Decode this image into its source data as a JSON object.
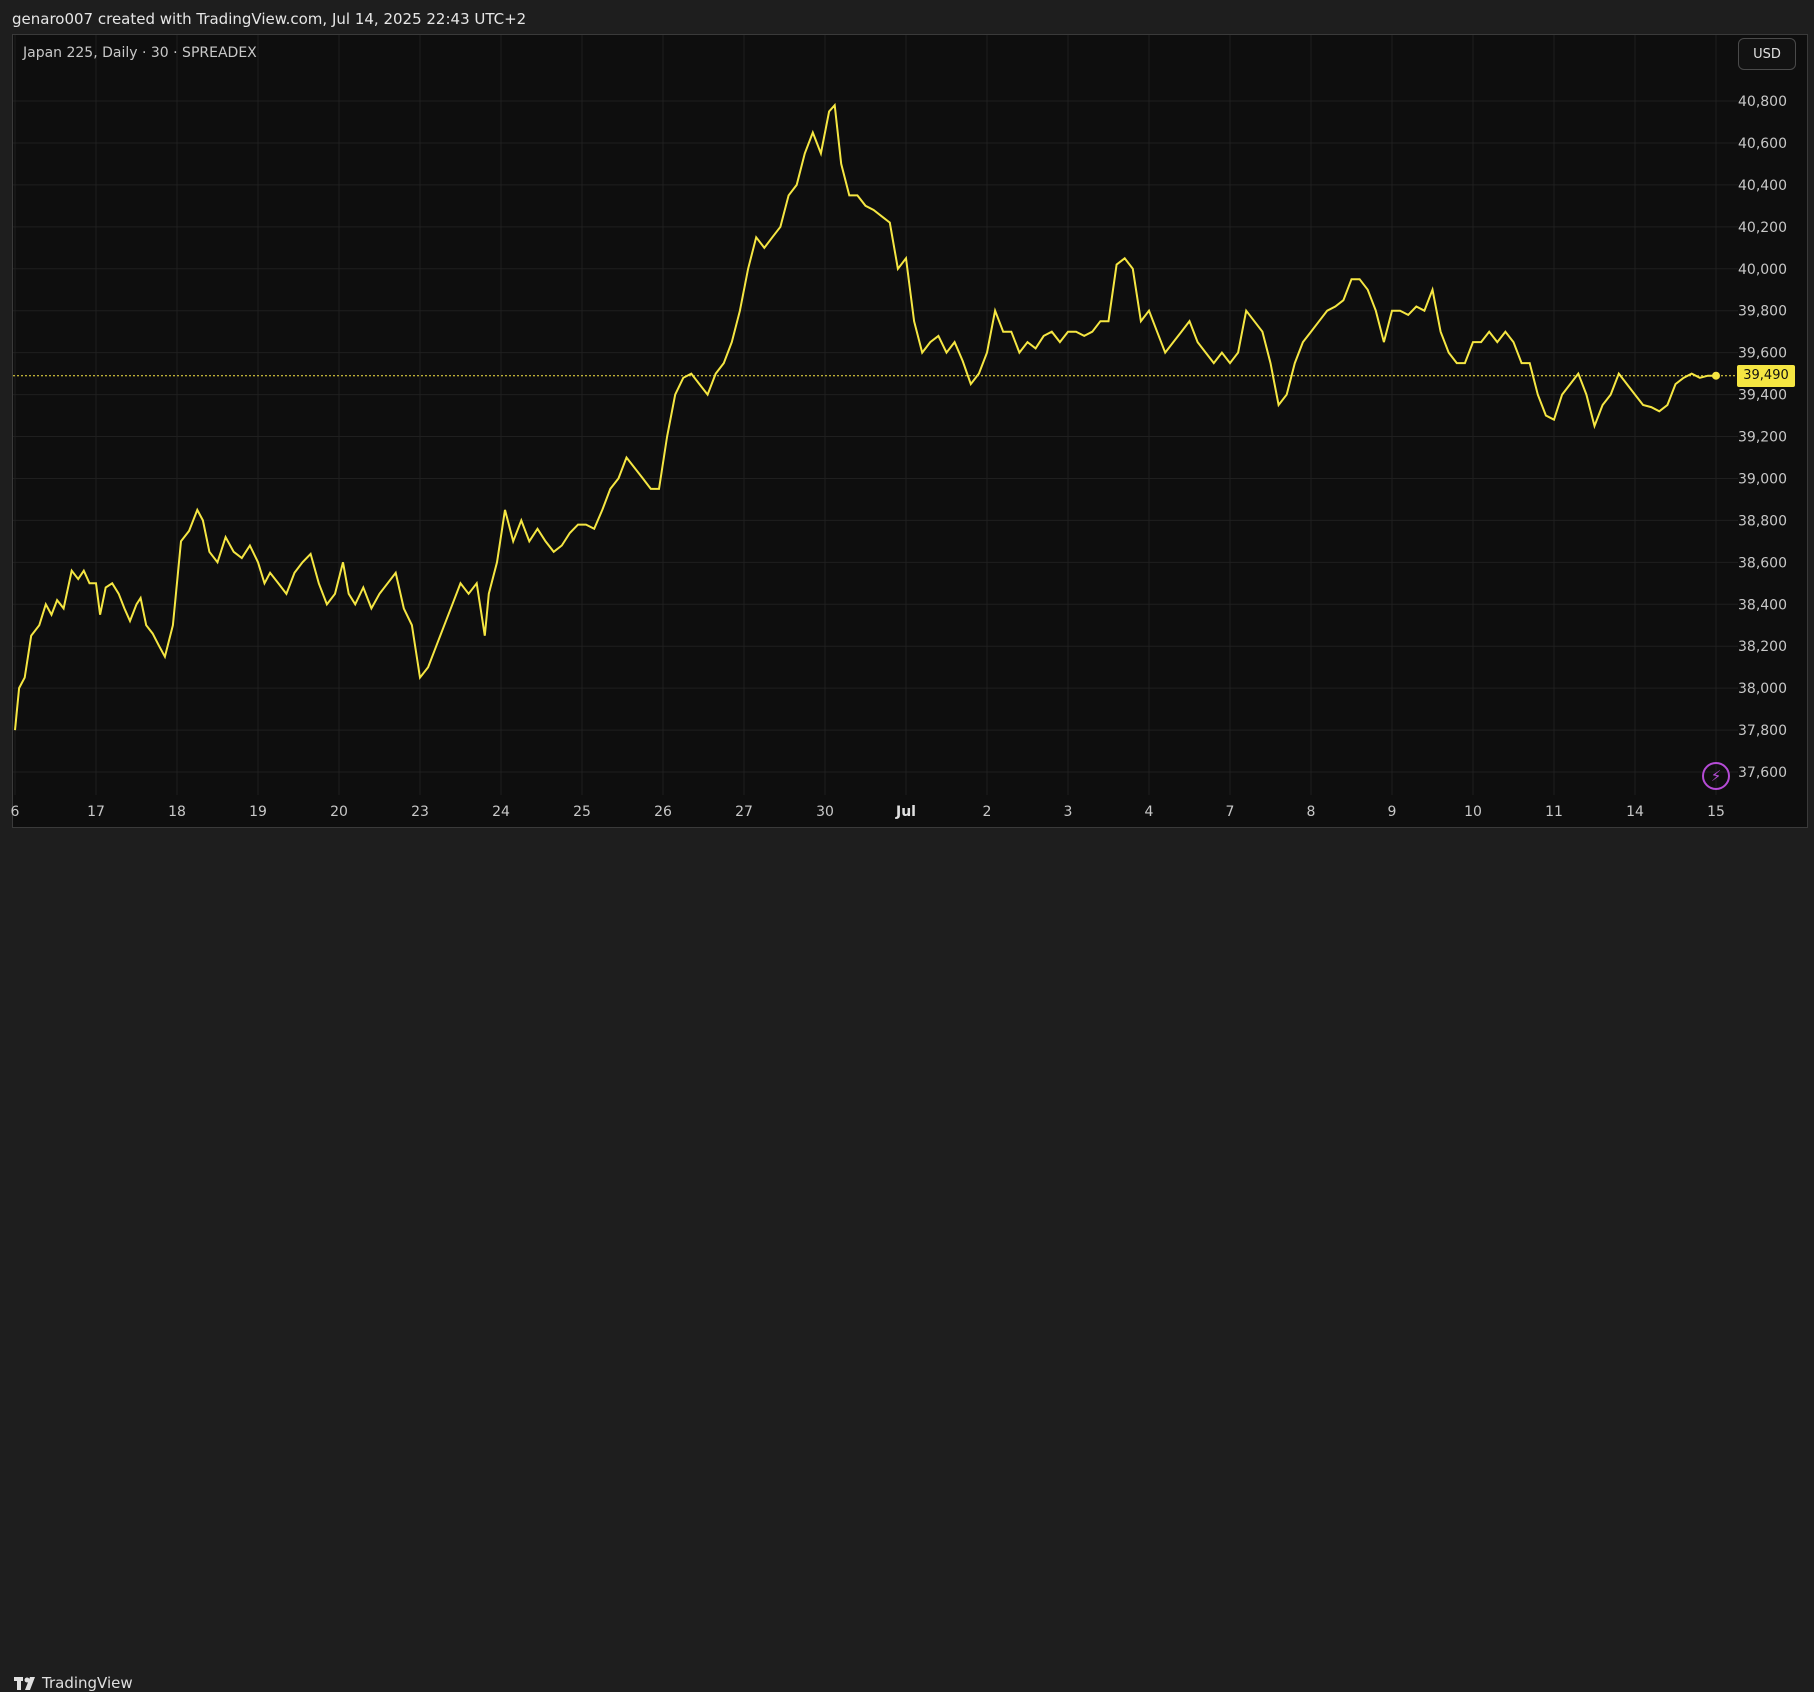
{
  "header": {
    "caption": "genaro007 created with TradingView.com, Jul 14, 2025 22:43 UTC+2"
  },
  "chart_header": {
    "symbol_info": "Japan 225, Daily · 30 · SPREADEX",
    "currency_label": "USD"
  },
  "footer": {
    "brand": "TradingView",
    "logo_icon": "tradingview-logo-icon"
  },
  "colors": {
    "line": "#f5e642",
    "price_label_bg": "#f5e642",
    "background": "#0e0e0e",
    "grid": "#1f1f1f",
    "bolt": "#b54bd6"
  },
  "chart_data": {
    "type": "line",
    "title": "",
    "xlabel": "",
    "ylabel": "",
    "ylim": [
      37550,
      40900
    ],
    "y_ticks": [
      37600,
      37800,
      38000,
      38200,
      38400,
      38600,
      38800,
      39000,
      39200,
      39400,
      39600,
      39800,
      40000,
      40200,
      40400,
      40600,
      40800
    ],
    "y_tick_labels": [
      "37,600",
      "37,800",
      "38,000",
      "38,200",
      "38,400",
      "38,600",
      "38,800",
      "39,000",
      "39,200",
      "39,400",
      "39,600",
      "39,800",
      "40,000",
      "40,200",
      "40,400",
      "40,600",
      "40,800"
    ],
    "x_ticks": [
      {
        "label": "6",
        "t": 0.0
      },
      {
        "label": "17",
        "t": 1.0
      },
      {
        "label": "18",
        "t": 2.0
      },
      {
        "label": "19",
        "t": 3.0
      },
      {
        "label": "20",
        "t": 4.0
      },
      {
        "label": "23",
        "t": 5.0
      },
      {
        "label": "24",
        "t": 6.0
      },
      {
        "label": "25",
        "t": 7.0
      },
      {
        "label": "26",
        "t": 8.0
      },
      {
        "label": "27",
        "t": 9.0
      },
      {
        "label": "30",
        "t": 10.0
      },
      {
        "label": "Jul",
        "t": 11.0,
        "bold": true
      },
      {
        "label": "2",
        "t": 12.0
      },
      {
        "label": "3",
        "t": 13.0
      },
      {
        "label": "4",
        "t": 14.0
      },
      {
        "label": "7",
        "t": 15.0
      },
      {
        "label": "8",
        "t": 16.0
      },
      {
        "label": "9",
        "t": 17.0
      },
      {
        "label": "10",
        "t": 18.0
      },
      {
        "label": "11",
        "t": 19.0
      },
      {
        "label": "14",
        "t": 20.0
      },
      {
        "label": "15",
        "t": 21.0
      }
    ],
    "last_price": 39490,
    "last_price_label": "39,490",
    "grid": true,
    "series": [
      {
        "points": [
          [
            0.0,
            37800
          ],
          [
            0.05,
            38000
          ],
          [
            0.12,
            38050
          ],
          [
            0.2,
            38250
          ],
          [
            0.3,
            38300
          ],
          [
            0.38,
            38400
          ],
          [
            0.45,
            38350
          ],
          [
            0.52,
            38420
          ],
          [
            0.6,
            38380
          ],
          [
            0.7,
            38560
          ],
          [
            0.78,
            38520
          ],
          [
            0.85,
            38560
          ],
          [
            0.92,
            38500
          ],
          [
            1.0,
            38500
          ],
          [
            1.05,
            38350
          ],
          [
            1.12,
            38480
          ],
          [
            1.2,
            38500
          ],
          [
            1.28,
            38450
          ],
          [
            1.35,
            38380
          ],
          [
            1.42,
            38320
          ],
          [
            1.5,
            38400
          ],
          [
            1.55,
            38430
          ],
          [
            1.62,
            38300
          ],
          [
            1.7,
            38260
          ],
          [
            1.78,
            38200
          ],
          [
            1.85,
            38150
          ],
          [
            1.95,
            38300
          ],
          [
            2.05,
            38700
          ],
          [
            2.15,
            38750
          ],
          [
            2.25,
            38850
          ],
          [
            2.32,
            38800
          ],
          [
            2.4,
            38650
          ],
          [
            2.5,
            38600
          ],
          [
            2.6,
            38720
          ],
          [
            2.7,
            38650
          ],
          [
            2.8,
            38620
          ],
          [
            2.9,
            38680
          ],
          [
            3.0,
            38600
          ],
          [
            3.08,
            38500
          ],
          [
            3.15,
            38550
          ],
          [
            3.25,
            38500
          ],
          [
            3.35,
            38450
          ],
          [
            3.45,
            38550
          ],
          [
            3.55,
            38600
          ],
          [
            3.65,
            38640
          ],
          [
            3.75,
            38500
          ],
          [
            3.85,
            38400
          ],
          [
            3.95,
            38450
          ],
          [
            4.05,
            38600
          ],
          [
            4.12,
            38450
          ],
          [
            4.2,
            38400
          ],
          [
            4.3,
            38480
          ],
          [
            4.4,
            38380
          ],
          [
            4.5,
            38450
          ],
          [
            4.6,
            38500
          ],
          [
            4.7,
            38550
          ],
          [
            4.8,
            38380
          ],
          [
            4.9,
            38300
          ],
          [
            5.0,
            38050
          ],
          [
            5.1,
            38100
          ],
          [
            5.2,
            38200
          ],
          [
            5.3,
            38300
          ],
          [
            5.4,
            38400
          ],
          [
            5.5,
            38500
          ],
          [
            5.6,
            38450
          ],
          [
            5.7,
            38500
          ],
          [
            5.8,
            38250
          ],
          [
            5.85,
            38450
          ],
          [
            5.95,
            38600
          ],
          [
            6.05,
            38850
          ],
          [
            6.15,
            38700
          ],
          [
            6.25,
            38800
          ],
          [
            6.35,
            38700
          ],
          [
            6.45,
            38760
          ],
          [
            6.55,
            38700
          ],
          [
            6.65,
            38650
          ],
          [
            6.75,
            38680
          ],
          [
            6.85,
            38740
          ],
          [
            6.95,
            38780
          ],
          [
            7.05,
            38780
          ],
          [
            7.15,
            38760
          ],
          [
            7.25,
            38850
          ],
          [
            7.35,
            38950
          ],
          [
            7.45,
            39000
          ],
          [
            7.55,
            39100
          ],
          [
            7.65,
            39050
          ],
          [
            7.75,
            39000
          ],
          [
            7.85,
            38950
          ],
          [
            7.95,
            38950
          ],
          [
            8.05,
            39200
          ],
          [
            8.15,
            39400
          ],
          [
            8.25,
            39480
          ],
          [
            8.35,
            39500
          ],
          [
            8.45,
            39450
          ],
          [
            8.55,
            39400
          ],
          [
            8.65,
            39500
          ],
          [
            8.75,
            39550
          ],
          [
            8.85,
            39650
          ],
          [
            8.95,
            39800
          ],
          [
            9.05,
            40000
          ],
          [
            9.15,
            40150
          ],
          [
            9.25,
            40100
          ],
          [
            9.35,
            40150
          ],
          [
            9.45,
            40200
          ],
          [
            9.55,
            40350
          ],
          [
            9.65,
            40400
          ],
          [
            9.75,
            40550
          ],
          [
            9.85,
            40650
          ],
          [
            9.95,
            40550
          ],
          [
            10.05,
            40750
          ],
          [
            10.12,
            40780
          ],
          [
            10.2,
            40500
          ],
          [
            10.3,
            40350
          ],
          [
            10.4,
            40350
          ],
          [
            10.5,
            40300
          ],
          [
            10.6,
            40280
          ],
          [
            10.7,
            40250
          ],
          [
            10.8,
            40220
          ],
          [
            10.9,
            40000
          ],
          [
            11.0,
            40050
          ],
          [
            11.1,
            39750
          ],
          [
            11.2,
            39600
          ],
          [
            11.3,
            39650
          ],
          [
            11.4,
            39680
          ],
          [
            11.5,
            39600
          ],
          [
            11.6,
            39650
          ],
          [
            11.7,
            39560
          ],
          [
            11.8,
            39450
          ],
          [
            11.9,
            39500
          ],
          [
            12.0,
            39600
          ],
          [
            12.1,
            39800
          ],
          [
            12.2,
            39700
          ],
          [
            12.3,
            39700
          ],
          [
            12.4,
            39600
          ],
          [
            12.5,
            39650
          ],
          [
            12.6,
            39620
          ],
          [
            12.7,
            39680
          ],
          [
            12.8,
            39700
          ],
          [
            12.9,
            39650
          ],
          [
            13.0,
            39700
          ],
          [
            13.1,
            39700
          ],
          [
            13.2,
            39680
          ],
          [
            13.3,
            39700
          ],
          [
            13.4,
            39750
          ],
          [
            13.5,
            39750
          ],
          [
            13.6,
            40020
          ],
          [
            13.7,
            40050
          ],
          [
            13.8,
            40000
          ],
          [
            13.9,
            39750
          ],
          [
            14.0,
            39800
          ],
          [
            14.1,
            39700
          ],
          [
            14.2,
            39600
          ],
          [
            14.3,
            39650
          ],
          [
            14.4,
            39700
          ],
          [
            14.5,
            39750
          ],
          [
            14.6,
            39650
          ],
          [
            14.7,
            39600
          ],
          [
            14.8,
            39550
          ],
          [
            14.9,
            39600
          ],
          [
            15.0,
            39550
          ],
          [
            15.1,
            39600
          ],
          [
            15.2,
            39800
          ],
          [
            15.3,
            39750
          ],
          [
            15.4,
            39700
          ],
          [
            15.5,
            39550
          ],
          [
            15.6,
            39350
          ],
          [
            15.7,
            39400
          ],
          [
            15.8,
            39550
          ],
          [
            15.9,
            39650
          ],
          [
            16.0,
            39700
          ],
          [
            16.1,
            39750
          ],
          [
            16.2,
            39800
          ],
          [
            16.3,
            39820
          ],
          [
            16.4,
            39850
          ],
          [
            16.5,
            39950
          ],
          [
            16.6,
            39950
          ],
          [
            16.7,
            39900
          ],
          [
            16.8,
            39800
          ],
          [
            16.9,
            39650
          ],
          [
            17.0,
            39800
          ],
          [
            17.1,
            39800
          ],
          [
            17.2,
            39780
          ],
          [
            17.3,
            39820
          ],
          [
            17.4,
            39800
          ],
          [
            17.5,
            39900
          ],
          [
            17.6,
            39700
          ],
          [
            17.7,
            39600
          ],
          [
            17.8,
            39550
          ],
          [
            17.9,
            39550
          ],
          [
            18.0,
            39650
          ],
          [
            18.1,
            39650
          ],
          [
            18.2,
            39700
          ],
          [
            18.3,
            39650
          ],
          [
            18.4,
            39700
          ],
          [
            18.5,
            39650
          ],
          [
            18.6,
            39550
          ],
          [
            18.7,
            39550
          ],
          [
            18.8,
            39400
          ],
          [
            18.9,
            39300
          ],
          [
            19.0,
            39280
          ],
          [
            19.1,
            39400
          ],
          [
            19.2,
            39450
          ],
          [
            19.3,
            39500
          ],
          [
            19.4,
            39400
          ],
          [
            19.5,
            39250
          ],
          [
            19.6,
            39350
          ],
          [
            19.7,
            39400
          ],
          [
            19.8,
            39500
          ],
          [
            19.9,
            39450
          ],
          [
            20.0,
            39400
          ],
          [
            20.1,
            39350
          ],
          [
            20.2,
            39340
          ],
          [
            20.3,
            39320
          ],
          [
            20.4,
            39350
          ],
          [
            20.5,
            39450
          ],
          [
            20.6,
            39480
          ],
          [
            20.7,
            39500
          ],
          [
            20.8,
            39480
          ],
          [
            20.9,
            39490
          ],
          [
            21.0,
            39490
          ]
        ]
      }
    ]
  }
}
